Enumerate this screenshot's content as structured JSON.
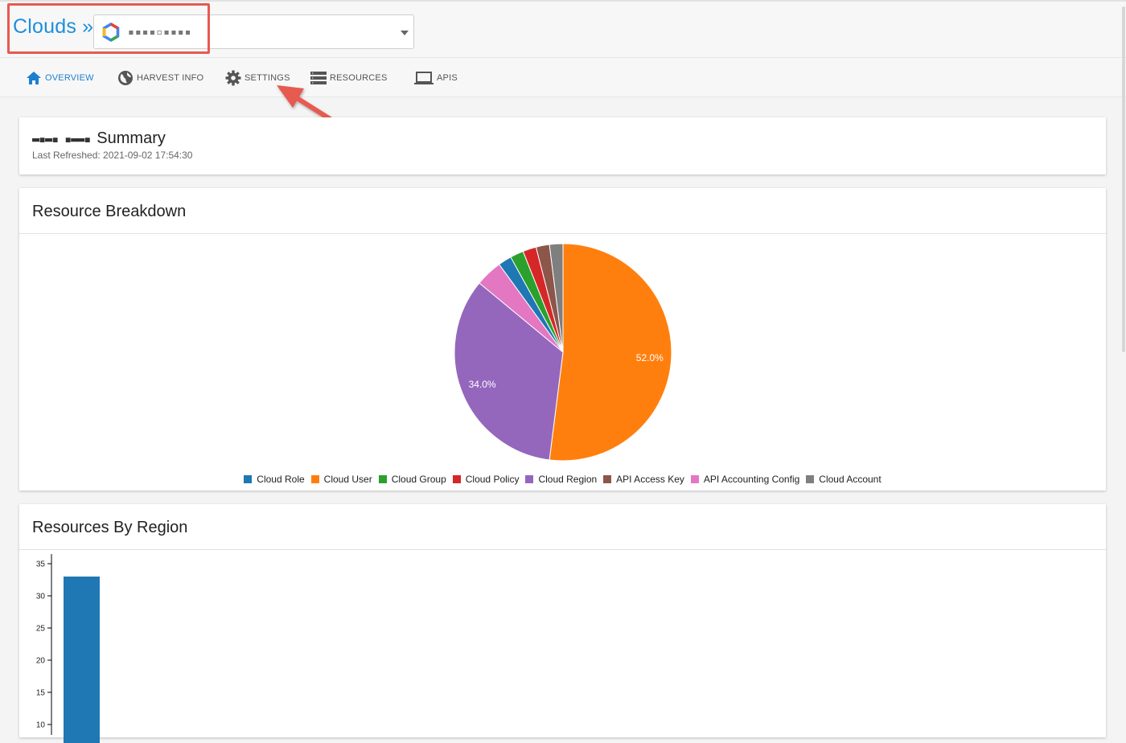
{
  "header": {
    "brand": "Clouds »",
    "cloud_select_value": "▪▪▪▪▫▪▪▪▪"
  },
  "nav": {
    "items": [
      {
        "label": "OVERVIEW",
        "icon": "home-icon",
        "active": true
      },
      {
        "label": "HARVEST INFO",
        "icon": "globe-icon",
        "active": false
      },
      {
        "label": "SETTINGS",
        "icon": "gear-icon",
        "active": false
      },
      {
        "label": "RESOURCES",
        "icon": "server-list-icon",
        "active": false
      },
      {
        "label": "APIS",
        "icon": "laptop-icon",
        "active": false
      }
    ]
  },
  "summary": {
    "name": "▬▪▬▪ ▪▬▬▪",
    "title": "Summary",
    "last_refreshed": "Last Refreshed: 2021-09-02 17:54:30"
  },
  "breakdown": {
    "title": "Resource Breakdown"
  },
  "region": {
    "title": "Resources By Region"
  },
  "colors": {
    "accent": "#1d8fdb",
    "highlight": "#e65a50"
  },
  "chart_data": [
    {
      "type": "pie",
      "labels": [
        "Cloud User",
        "Cloud Region",
        "API Accounting Config",
        "Cloud Role",
        "Cloud Group",
        "Cloud Policy",
        "API Access Key",
        "Cloud Account"
      ],
      "values": [
        52.0,
        34.0,
        4.0,
        2.0,
        2.0,
        2.0,
        2.0,
        2.0
      ],
      "colors": [
        "#ff7f0e",
        "#9467bd",
        "#e377c2",
        "#1f77b4",
        "#2ca02c",
        "#d62728",
        "#8c564b",
        "#7f7f7f"
      ],
      "data_labels": [
        "52.0%",
        "34.0%",
        "",
        "",
        "",
        "",
        "",
        ""
      ],
      "legend": [
        {
          "name": "Cloud Role",
          "color": "#1f77b4"
        },
        {
          "name": "Cloud User",
          "color": "#ff7f0e"
        },
        {
          "name": "Cloud Group",
          "color": "#2ca02c"
        },
        {
          "name": "Cloud Policy",
          "color": "#d62728"
        },
        {
          "name": "Cloud Region",
          "color": "#9467bd"
        },
        {
          "name": "API Access Key",
          "color": "#8c564b"
        },
        {
          "name": "API Accounting Config",
          "color": "#e377c2"
        },
        {
          "name": "Cloud Account",
          "color": "#7f7f7f"
        }
      ],
      "legend_position": "bottom"
    },
    {
      "type": "bar",
      "categories": [
        ""
      ],
      "values": [
        33
      ],
      "color": "#1f77b4",
      "yticks": [
        10,
        15,
        20,
        25,
        30,
        35
      ],
      "ylim": [
        9,
        36.5
      ]
    }
  ]
}
